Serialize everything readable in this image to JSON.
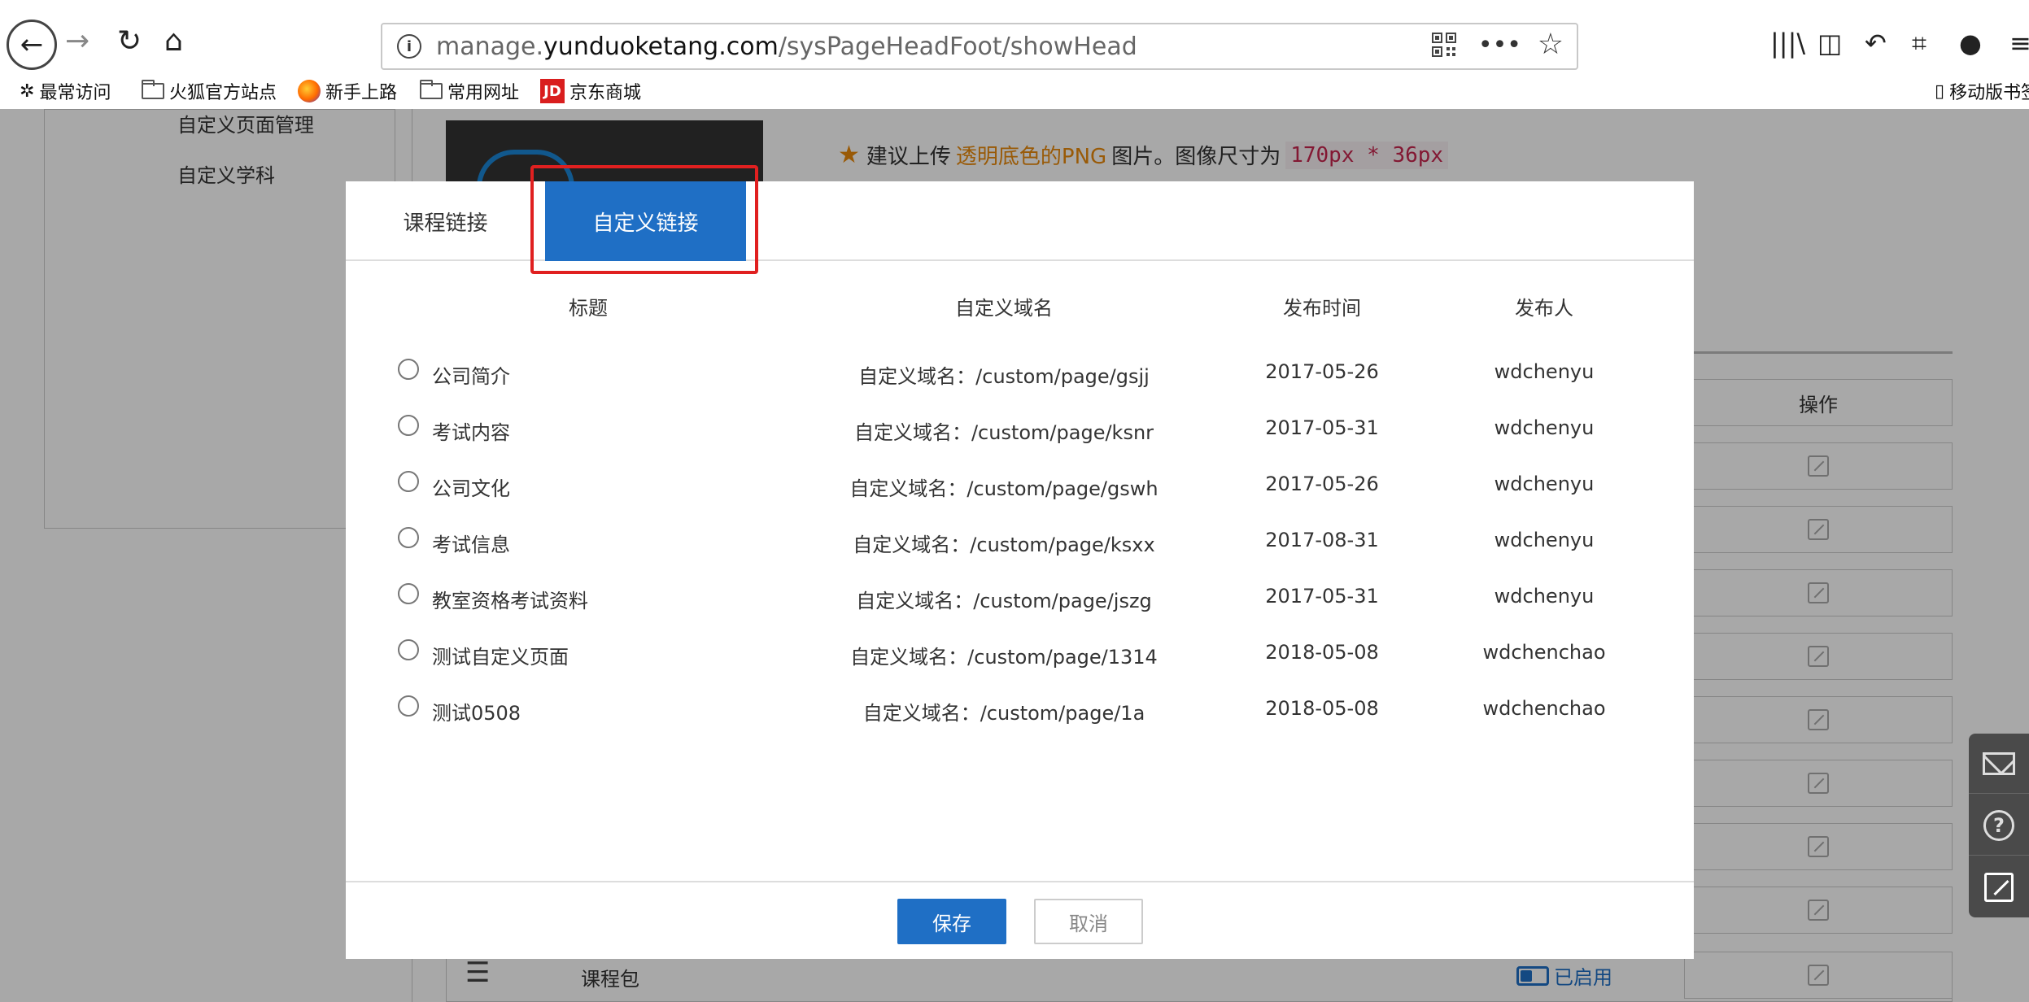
{
  "browser": {
    "url_prefix": "manage.",
    "url_domain": "yunduoketang.com",
    "url_path": "/sysPageHeadFoot/showHead"
  },
  "bookmarks": {
    "most_visited": "最常访问",
    "firefox_official": "火狐官方站点",
    "new_user": "新手上路",
    "common_sites": "常用网址",
    "jd_badge": "JD",
    "jd_mall": "京东商城",
    "mobile_bookmarks": "移动版书签"
  },
  "sidebar": {
    "items": [
      "自定义页面管理",
      "自定义学科"
    ]
  },
  "upload_hint": {
    "prefix": "建议上传",
    "highlight": "透明底色的PNG",
    "middle": "图片。图像尺寸为",
    "size": "170px * 36px"
  },
  "background_table": {
    "operation_header": "操作",
    "bottom_row_label": "课程包",
    "enabled_label": "已启用"
  },
  "modal": {
    "tabs": {
      "course_link": "课程链接",
      "custom_link": "自定义链接"
    },
    "columns": {
      "title": "标题",
      "domain": "自定义域名",
      "date": "发布时间",
      "author": "发布人"
    },
    "rows": [
      {
        "title": "公司简介",
        "domain": "自定义域名：/custom/page/gsjj",
        "date": "2017-05-26",
        "author": "wdchenyu"
      },
      {
        "title": "考试内容",
        "domain": "自定义域名：/custom/page/ksnr",
        "date": "2017-05-31",
        "author": "wdchenyu"
      },
      {
        "title": "公司文化",
        "domain": "自定义域名：/custom/page/gswh",
        "date": "2017-05-26",
        "author": "wdchenyu"
      },
      {
        "title": "考试信息",
        "domain": "自定义域名：/custom/page/ksxx",
        "date": "2017-08-31",
        "author": "wdchenyu"
      },
      {
        "title": "教室资格考试资料",
        "domain": "自定义域名：/custom/page/jszg",
        "date": "2017-05-31",
        "author": "wdchenyu"
      },
      {
        "title": "测试自定义页面",
        "domain": "自定义域名：/custom/page/1314",
        "date": "2018-05-08",
        "author": "wdchenchao"
      },
      {
        "title": "测试0508",
        "domain": "自定义域名：/custom/page/1a",
        "date": "2018-05-08",
        "author": "wdchenchao"
      }
    ],
    "save_label": "保存",
    "cancel_label": "取消"
  },
  "colors": {
    "primary": "#1f6fc5",
    "highlight_border": "#e02020",
    "hint_orange": "#e8890c"
  }
}
